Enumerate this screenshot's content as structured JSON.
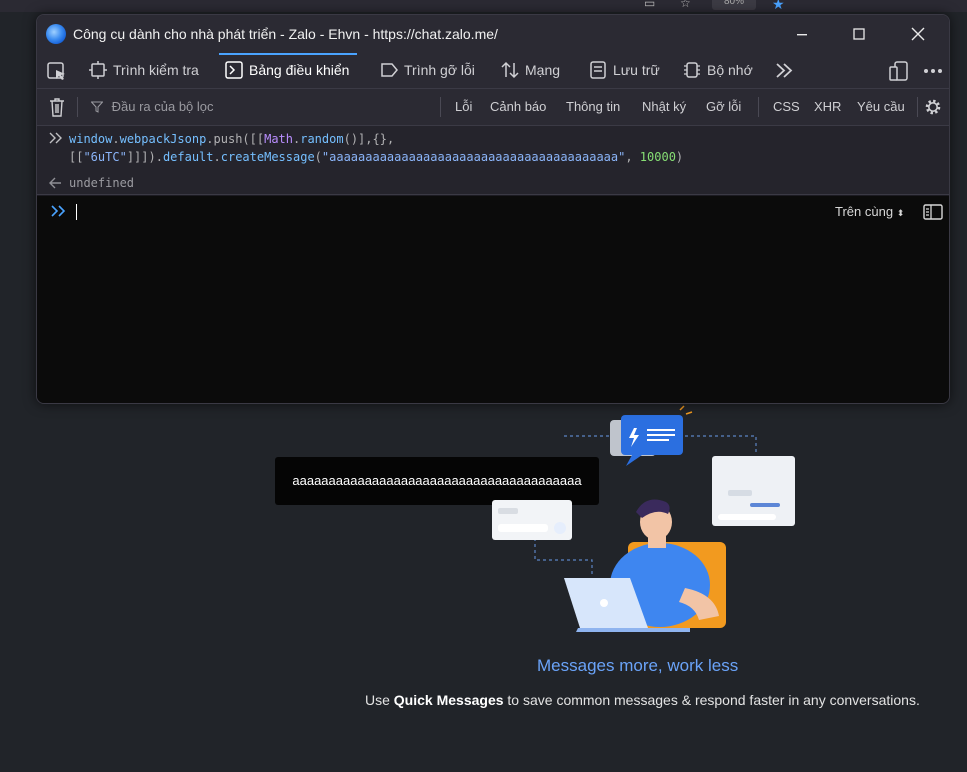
{
  "browser_strip": {
    "zoom": "80%"
  },
  "devtools": {
    "window_title": "Công cụ dành cho nhà phát triển - Zalo - Ehvn - https://chat.zalo.me/",
    "tabs": [
      {
        "label": "Trình kiểm tra",
        "icon": "inspector-icon"
      },
      {
        "label": "Bảng điều khiển",
        "icon": "console-icon",
        "selected": true
      },
      {
        "label": "Trình gỡ lỗi",
        "icon": "debugger-icon"
      },
      {
        "label": "Mạng",
        "icon": "network-icon"
      },
      {
        "label": "Lưu trữ",
        "icon": "storage-icon"
      },
      {
        "label": "Bộ nhớ",
        "icon": "memory-icon"
      }
    ],
    "filter": {
      "placeholder": "Đầu ra của bộ lọc",
      "levels": [
        "Lỗi",
        "Cảnh báo",
        "Thông tin",
        "Nhật ký",
        "Gỡ lỗi"
      ],
      "types": [
        "CSS",
        "XHR",
        "Yêu cầu"
      ]
    },
    "console": {
      "input_line1_parts": [
        "window",
        ".",
        "webpackJsonp",
        ".push([[",
        "Math",
        ".",
        "random",
        "()],{},"
      ],
      "input_line2_parts": [
        "[[",
        "\"6uTC\"",
        "]]]).",
        "default",
        ".",
        "createMessage",
        "(",
        "\"aaaaaaaaaaaaaaaaaaaaaaaaaaaaaaaaaaaaaaaa\"",
        ", ",
        "10000",
        ")"
      ],
      "result": "undefined",
      "editor_mode": "Trên cùng"
    }
  },
  "app": {
    "toast_text": "aaaaaaaaaaaaaaaaaaaaaaaaaaaaaaaaaaaaaaaa",
    "title": "Messages more, work less",
    "subtitle_pre": "Use ",
    "subtitle_bold": "Quick Messages",
    "subtitle_post": " to save common messages & respond faster in any conversations."
  },
  "colors": {
    "accent": "#4aa3ff",
    "title_blue": "#6aa3f8",
    "panel_bg": "#1c1b22",
    "toolbar_bg": "#2b2a33"
  }
}
